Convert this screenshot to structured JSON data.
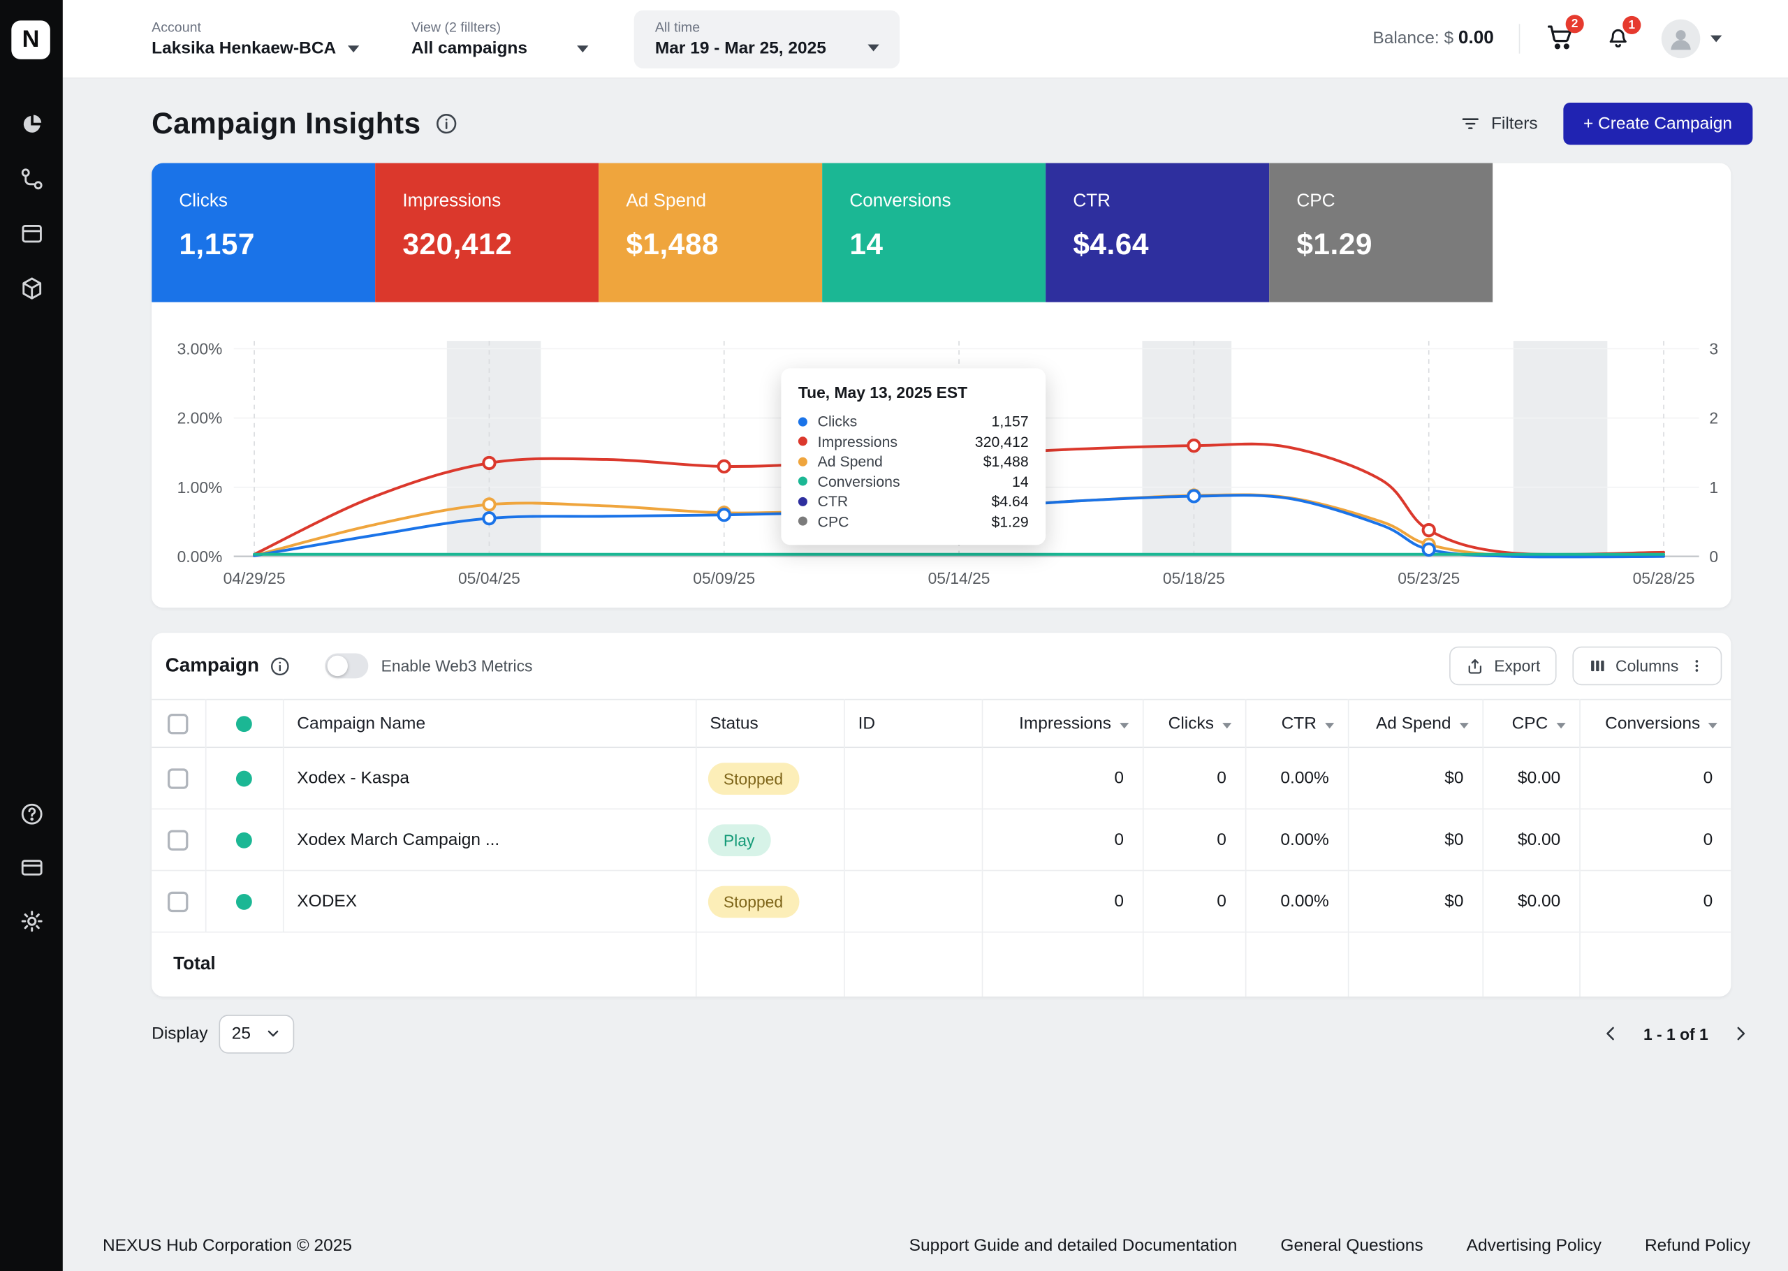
{
  "app": {
    "logo_letter": "N"
  },
  "topbar": {
    "account_label": "Account",
    "account_value": "Laksika Henkaew-BCA",
    "view_label": "View (2 fillters)",
    "view_value": "All campaigns",
    "daterange_label": "All time",
    "daterange_value": "Mar 19 - Mar 25, 2025",
    "balance_label": "Balance: $",
    "balance_value": "0.00",
    "cart_badge": "2",
    "notification_badge": "1"
  },
  "page": {
    "title": "Campaign Insights",
    "filters_label": "Filters",
    "create_campaign_label": "+ Create Campaign"
  },
  "metric_tiles": [
    {
      "label": "Clicks",
      "value": "1,157",
      "color": "#1A73E8"
    },
    {
      "label": "Impressions",
      "value": "320,412",
      "color": "#DB382C"
    },
    {
      "label": "Ad Spend",
      "value": "$1,488",
      "color": "#EFA53D"
    },
    {
      "label": "Conversions",
      "value": "14",
      "color": "#1BB794"
    },
    {
      "label": "CTR",
      "value": "$4.64",
      "color": "#2E2F9E"
    },
    {
      "label": "CPC",
      "value": "$1.29",
      "color": "#7B7B7B"
    }
  ],
  "chart_data": {
    "type": "line",
    "x_tick_labels": [
      "04/29/25",
      "05/04/25",
      "05/09/25",
      "05/14/25",
      "05/18/25",
      "05/23/25",
      "05/28/25"
    ],
    "y_axis_left": {
      "tick_labels": [
        "0.00%",
        "1.00%",
        "2.00%",
        "3.00%"
      ],
      "min": 0,
      "max": 3
    },
    "y_axis_right": {
      "tick_labels": [
        "0",
        "1",
        "2",
        "3"
      ],
      "min": 0,
      "max": 3
    },
    "grid": {
      "vertical_dashed": true,
      "weekend_bands": [
        [
          0.82,
          1.22
        ],
        [
          3.78,
          4.16
        ],
        [
          5.36,
          5.76
        ]
      ]
    },
    "series": [
      {
        "name": "Impressions",
        "color": "#DB382C",
        "points": [
          [
            0,
            0.03
          ],
          [
            0.5,
            0.85
          ],
          [
            1,
            1.35
          ],
          [
            1.5,
            1.4
          ],
          [
            2,
            1.3
          ],
          [
            2.5,
            1.36
          ],
          [
            3,
            1.46
          ],
          [
            3.5,
            1.55
          ],
          [
            4,
            1.6
          ],
          [
            4.4,
            1.58
          ],
          [
            4.8,
            1.1
          ],
          [
            5,
            0.38
          ],
          [
            5.35,
            0.05
          ],
          [
            6,
            0.06
          ]
        ],
        "markers": [
          [
            1,
            1.35
          ],
          [
            2,
            1.3
          ],
          [
            4,
            1.6
          ],
          [
            5,
            0.38
          ]
        ]
      },
      {
        "name": "Ad Spend",
        "color": "#EFA53D",
        "points": [
          [
            0,
            0.01
          ],
          [
            0.5,
            0.45
          ],
          [
            1,
            0.75
          ],
          [
            1.5,
            0.73
          ],
          [
            2,
            0.63
          ],
          [
            2.5,
            0.66
          ],
          [
            3,
            0.7
          ],
          [
            3.5,
            0.8
          ],
          [
            4,
            0.88
          ],
          [
            4.4,
            0.85
          ],
          [
            4.8,
            0.5
          ],
          [
            5,
            0.17
          ],
          [
            5.35,
            0.01
          ],
          [
            6,
            0.01
          ]
        ],
        "markers": [
          [
            1,
            0.75
          ],
          [
            2,
            0.63
          ],
          [
            4,
            0.88
          ],
          [
            5,
            0.17
          ]
        ]
      },
      {
        "name": "Clicks",
        "color": "#1A73E8",
        "points": [
          [
            0,
            0.01
          ],
          [
            0.5,
            0.3
          ],
          [
            1,
            0.55
          ],
          [
            1.5,
            0.58
          ],
          [
            2,
            0.6
          ],
          [
            2.5,
            0.64
          ],
          [
            3,
            0.69
          ],
          [
            3.5,
            0.8
          ],
          [
            4,
            0.87
          ],
          [
            4.4,
            0.84
          ],
          [
            4.8,
            0.45
          ],
          [
            5,
            0.1
          ],
          [
            5.35,
            0.0
          ],
          [
            6,
            0.0
          ]
        ],
        "markers": [
          [
            1,
            0.55
          ],
          [
            2,
            0.6
          ],
          [
            4,
            0.87
          ],
          [
            5,
            0.1
          ]
        ]
      },
      {
        "name": "Conversions",
        "color": "#1BB794",
        "points": [
          [
            0,
            0.03
          ],
          [
            6,
            0.03
          ]
        ],
        "markers": []
      }
    ]
  },
  "chart_tooltip": {
    "title": "Tue, May 13, 2025 EST",
    "rows": [
      {
        "label": "Clicks",
        "value": "1,157",
        "color": "#1A73E8"
      },
      {
        "label": "Impressions",
        "value": "320,412",
        "color": "#DB382C"
      },
      {
        "label": "Ad Spend",
        "value": "$1,488",
        "color": "#EFA53D"
      },
      {
        "label": "Conversions",
        "value": "14",
        "color": "#1BB794"
      },
      {
        "label": "CTR",
        "value": "$4.64",
        "color": "#2E2F9E"
      },
      {
        "label": "CPC",
        "value": "$1.29",
        "color": "#7B7B7B"
      }
    ]
  },
  "campaign_table": {
    "title": "Campaign",
    "toggle_label": "Enable Web3 Metrics",
    "export_label": "Export",
    "columns_label": "Columns",
    "headers": [
      "Campaign Name",
      "Status",
      "ID",
      "Impressions",
      "Clicks",
      "CTR",
      "Ad Spend",
      "CPC",
      "Conversions"
    ],
    "rows": [
      {
        "name": "Xodex - Kaspa",
        "status": "Stopped",
        "status_type": "stopped",
        "id": "",
        "impressions": "0",
        "clicks": "0",
        "ctr": "0.00%",
        "ad_spend": "$0",
        "cpc": "$0.00",
        "conversions": "0"
      },
      {
        "name": "Xodex March Campaign ...",
        "status": "Play",
        "status_type": "play",
        "id": "",
        "impressions": "0",
        "clicks": "0",
        "ctr": "0.00%",
        "ad_spend": "$0",
        "cpc": "$0.00",
        "conversions": "0"
      },
      {
        "name": "XODEX",
        "status": "Stopped",
        "status_type": "stopped",
        "id": "",
        "impressions": "0",
        "clicks": "0",
        "ctr": "0.00%",
        "ad_spend": "$0",
        "cpc": "$0.00",
        "conversions": "0"
      }
    ],
    "total_label": "Total",
    "display_label": "Display",
    "display_value": "25",
    "pagination_text": "1 - 1 of 1"
  },
  "footer": {
    "copyright": "NEXUS Hub Corporation © 2025",
    "links": [
      "Support Guide and detailed Documentation",
      "General Questions",
      "Advertising Policy",
      "Refund Policy"
    ]
  }
}
